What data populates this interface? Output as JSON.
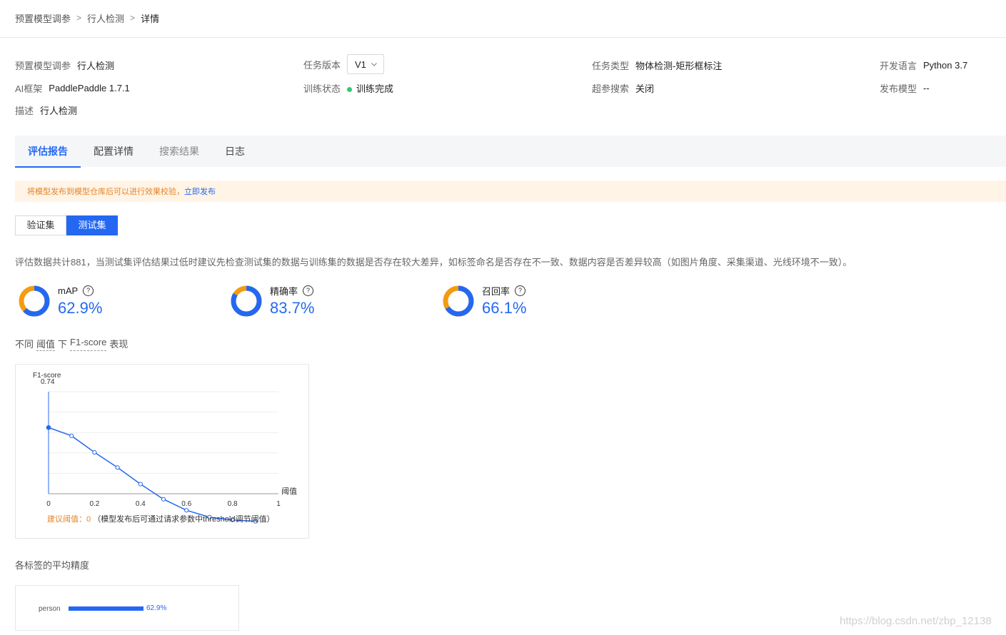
{
  "breadcrumb": {
    "items": [
      "预置模型调参",
      "行人检测"
    ],
    "current": "详情"
  },
  "info": {
    "preset_label": "预置模型调参",
    "preset_value": "行人检测",
    "version_label": "任务版本",
    "version_value": "V1",
    "task_type_label": "任务类型",
    "task_type_value": "物体检测-矩形框标注",
    "language_label": "开发语言",
    "language_value": "Python 3.7",
    "framework_label": "AI框架",
    "framework_value": "PaddlePaddle 1.7.1",
    "train_status_label": "训练状态",
    "train_status_value": "训练完成",
    "hyper_search_label": "超参搜索",
    "hyper_search_value": "关闭",
    "publish_label": "发布模型",
    "publish_value": "--",
    "desc_label": "描述",
    "desc_value": "行人检测"
  },
  "tabs": [
    "评估报告",
    "配置详情",
    "搜索结果",
    "日志"
  ],
  "notice": {
    "text": "将模型发布到模型仓库后可以进行效果校验，",
    "link": "立即发布"
  },
  "segment": {
    "validation": "验证集",
    "test": "测试集"
  },
  "description": "评估数据共计881，当测试集评估结果过低时建议先检查测试集的数据与训练集的数据是否存在较大差异，如标签命名是否存在不一致、数据内容是否差异较高（如图片角度、采集渠道、光线环境不一致）。",
  "metrics": [
    {
      "name": "mAP",
      "value": "62.9%",
      "fraction": 0.629
    },
    {
      "name": "精确率",
      "value": "83.7%",
      "fraction": 0.837
    },
    {
      "name": "召回率",
      "value": "66.1%",
      "fraction": 0.661
    }
  ],
  "colors": {
    "primary": "#2468f2",
    "secondary": "#f39c12",
    "status_ok": "#2ecc71"
  },
  "f1_section": {
    "p1": "不同",
    "p2": "阈值",
    "p3": "下",
    "p4": "F1-score",
    "p5": "表现"
  },
  "chart_data": {
    "type": "line",
    "ylabel": "F1-score",
    "xlabel": "阈值",
    "y_top_label": "0.74",
    "xlim": [
      0,
      1
    ],
    "ylim": [
      0,
      0.74
    ],
    "x_ticks": [
      "0",
      "0.2",
      "0.4",
      "0.6",
      "0.8",
      "1"
    ],
    "x": [
      0,
      0.1,
      0.2,
      0.3,
      0.4,
      0.5,
      0.6,
      0.7,
      0.8,
      0.9
    ],
    "y": [
      0.48,
      0.42,
      0.3,
      0.19,
      0.07,
      -0.04,
      -0.12,
      -0.17,
      -0.19,
      -0.2
    ],
    "note_label": "建议阈值：0",
    "note_text": "（模型发布后可通过请求参数中threshold调节阈值）"
  },
  "ap_section": {
    "title": "各标签的平均精度"
  },
  "ap_data": [
    {
      "label": "person",
      "value": "62.9%",
      "fraction": 0.629
    }
  ],
  "watermark": "https://blog.csdn.net/zbp_12138"
}
